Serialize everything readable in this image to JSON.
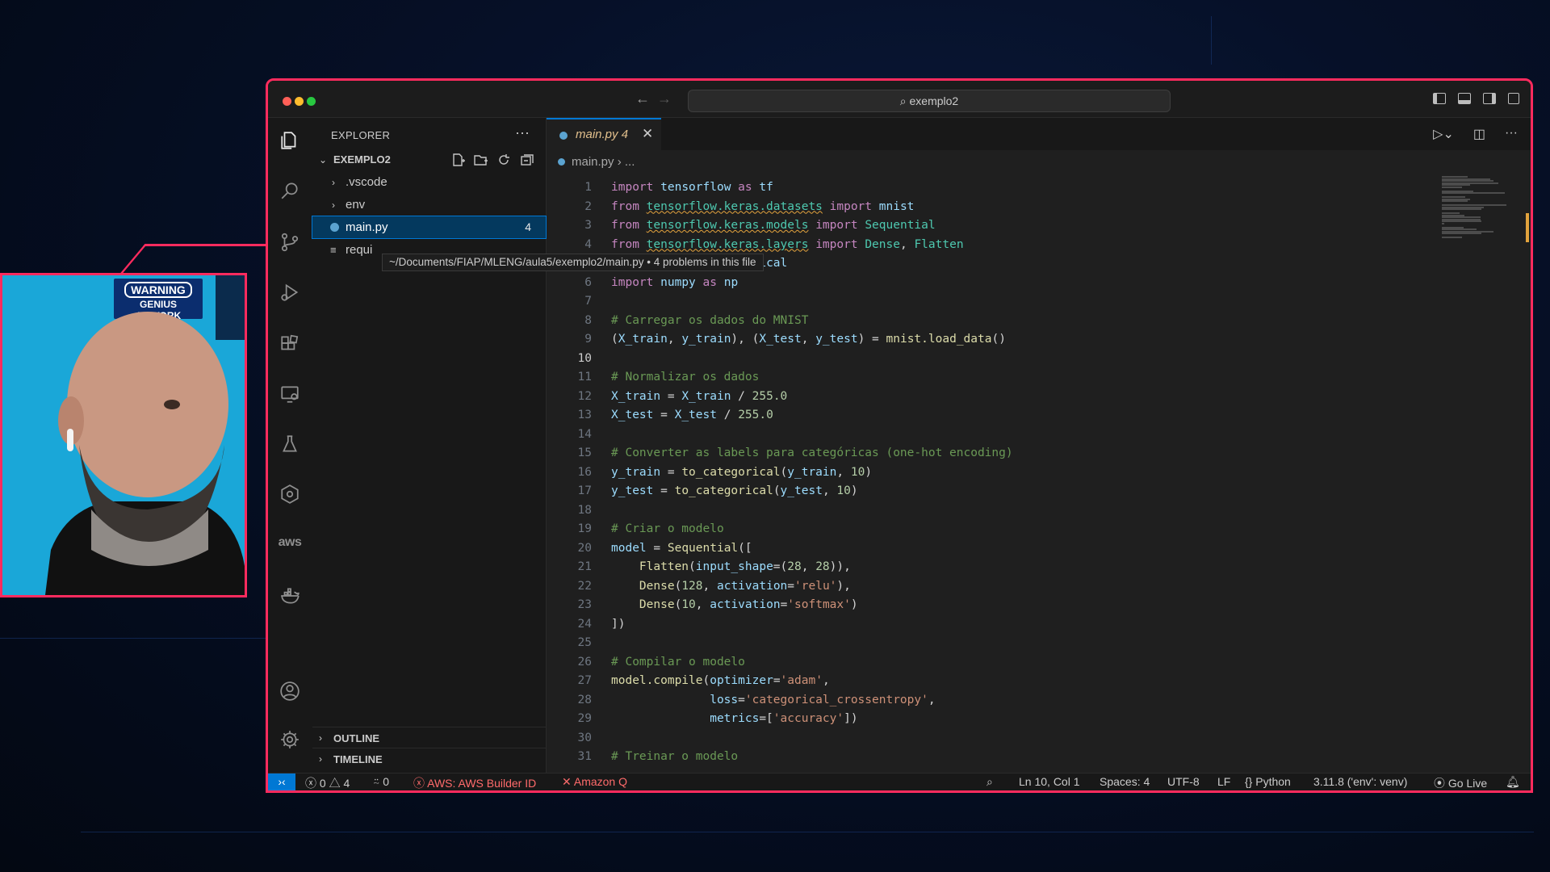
{
  "titlebar": {
    "search_text": "exemplo2"
  },
  "sidebar": {
    "title": "EXPLORER",
    "project": "EXEMPLO2",
    "items": [
      {
        "label": ".vscode",
        "type": "folder"
      },
      {
        "label": "env",
        "type": "folder"
      },
      {
        "label": "main.py",
        "type": "file",
        "badge": "4",
        "selected": true
      },
      {
        "label": "requi",
        "type": "file"
      }
    ],
    "tooltip": "~/Documents/FIAP/MLENG/aula5/exemplo2/main.py • 4 problems in this file",
    "sections": [
      "OUTLINE",
      "TIMELINE"
    ]
  },
  "editor": {
    "tab": {
      "label": "main.py 4"
    },
    "breadcrumb": {
      "file": "main.py",
      "rest": "..."
    },
    "current_line": 10
  },
  "code_lines": [
    "import tensorflow as tf",
    "from tensorflow.keras.datasets import mnist",
    "from tensorflow.keras.models import Sequential",
    "from tensorflow.keras.layers import Dense, Flatten",
    "... import to_categorical",
    "import numpy as np",
    "",
    "# Carregar os dados do MNIST",
    "(X_train, y_train), (X_test, y_test) = mnist.load_data()",
    "",
    "# Normalizar os dados",
    "X_train = X_train / 255.0",
    "X_test = X_test / 255.0",
    "",
    "# Converter as labels para categóricas (one-hot encoding)",
    "y_train = to_categorical(y_train, 10)",
    "y_test = to_categorical(y_test, 10)",
    "",
    "# Criar o modelo",
    "model = Sequential([",
    "    Flatten(input_shape=(28, 28)),",
    "    Dense(128, activation='relu'),",
    "    Dense(10, activation='softmax')",
    "])",
    "",
    "# Compilar o modelo",
    "model.compile(optimizer='adam',",
    "              loss='categorical_crossentropy',",
    "              metrics=['accuracy'])",
    "",
    "# Treinar o modelo"
  ],
  "statusbar": {
    "errors": "0",
    "warnings": "4",
    "ports": "0",
    "aws": "AWS: AWS Builder ID",
    "amazon_q": "Amazon Q",
    "position": "Ln 10, Col 1",
    "spaces": "Spaces: 4",
    "encoding": "UTF-8",
    "eol": "LF",
    "language": "Python",
    "interpreter": "3.11.8 ('env': venv)",
    "golive": "Go Live"
  },
  "webcam": {
    "sign_line1": "WARNING",
    "sign_line2": "GENIUS",
    "sign_line3": "AT WORK"
  },
  "colors": {
    "accent": "#ff2b5e",
    "selection": "#04395e",
    "focus": "#0078d4"
  }
}
